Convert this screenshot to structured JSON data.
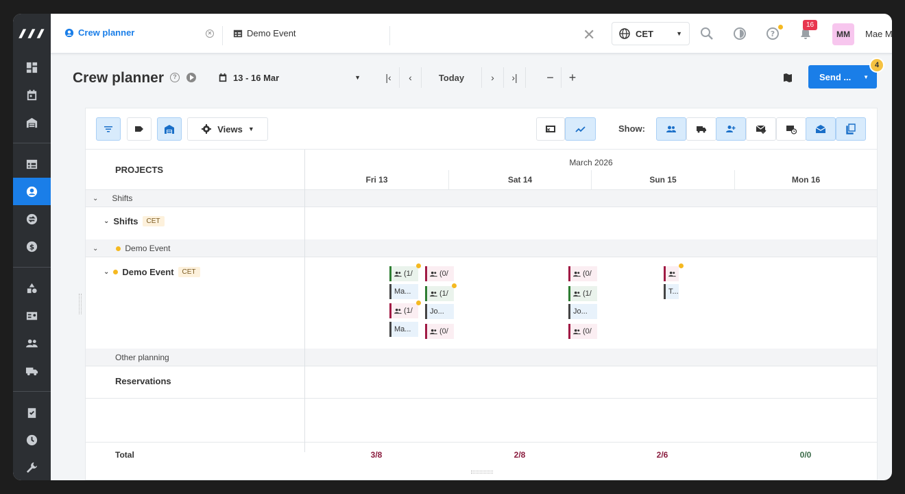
{
  "topbar": {
    "tab_active": "Crew planner",
    "tab_second": "Demo Event",
    "timezone": "CET",
    "notifications_count": "16",
    "avatar_initials": "MM",
    "user_name": "Mae M"
  },
  "header": {
    "title": "Crew planner",
    "date_range": "13 - 16 Mar",
    "today_label": "Today",
    "send_label": "Send ...",
    "send_badge": "4"
  },
  "toolbar": {
    "views_label": "Views",
    "show_label": "Show:"
  },
  "grid": {
    "projects_header": "PROJECTS",
    "month": "March 2026",
    "days": [
      "Fri 13",
      "Sat 14",
      "Sun 15",
      "Mon 16"
    ],
    "rows": {
      "group_shifts": "Shifts",
      "shifts": "Shifts",
      "shifts_tz": "CET",
      "group_demo": "Demo Event",
      "demo": "Demo Event",
      "demo_tz": "CET",
      "other_planning": "Other planning",
      "reservations": "Reservations"
    },
    "chips": {
      "c1": "(1/",
      "c2": "(0/",
      "c3": "Ma...",
      "c4": "(1/",
      "c5": "(1/",
      "c6": "Jo...",
      "c7": "Ma...",
      "c8": "(0/",
      "c9": "(0/",
      "c10": "(1/",
      "c11": "Jo...",
      "c12": "(0/",
      "c13": "T..."
    },
    "total_label": "Total",
    "totals": [
      "3/8",
      "2/8",
      "2/6",
      "0/0"
    ]
  },
  "colors": {
    "accent": "#1a7ee8",
    "rail": "#2c2f33",
    "chip_green": "#2e7d32",
    "chip_red": "#a01a44",
    "badge_yellow": "#f5b921"
  }
}
